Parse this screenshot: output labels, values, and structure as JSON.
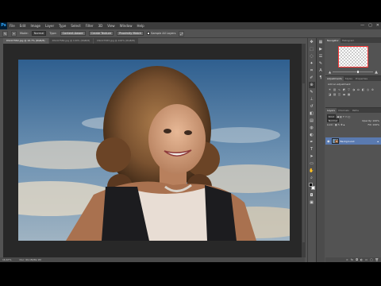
{
  "app": {
    "logo": "Ps"
  },
  "menu": [
    "File",
    "Edit",
    "Image",
    "Layer",
    "Type",
    "Select",
    "Filter",
    "3D",
    "View",
    "Window",
    "Help"
  ],
  "window_controls": [
    "—",
    "▢",
    "✕"
  ],
  "options_bar": {
    "mode_label": "Mode:",
    "mode_value": "Normal",
    "type_label": "Type:",
    "buttons": [
      "Content-Aware",
      "Create Texture",
      "Proximity Match"
    ],
    "sample_label": "Sample All Layers"
  },
  "document_tabs": [
    {
      "label": "DSC07582.jpg @ 16.7% (RGB/8)",
      "active": true
    },
    {
      "label": "DSC07582.jpg @ 100% (RGB/8)",
      "active": false
    },
    {
      "label": "DSC07583.jpg @ 100% (RGB/8)",
      "active": false
    }
  ],
  "status_bar": {
    "zoom": "16.67%",
    "doc": "Doc: 69.1M/69.1M"
  },
  "panels": {
    "navigator": {
      "tabs": [
        "Navigator",
        "Histogram"
      ]
    },
    "adjustments": {
      "tabs": [
        "Adjustments",
        "Styles",
        "Properties"
      ],
      "title": "Add an adjustment"
    },
    "layers": {
      "tabs": [
        "Layers",
        "Channels",
        "Paths"
      ],
      "kind_label": "Kind",
      "blend": "Normal",
      "opacity_label": "Opacity: 100%",
      "lock_label": "Lock:",
      "fill_label": "Fill: 100%",
      "layer_name": "Background"
    }
  },
  "colors": {
    "accent_selected_layer": "#5a7ab0",
    "nav_box": "#ff3b3b"
  }
}
